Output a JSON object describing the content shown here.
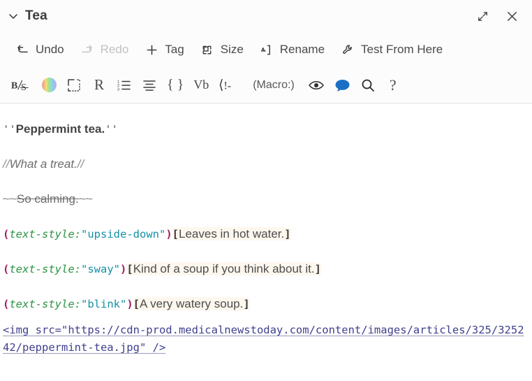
{
  "window": {
    "passage_title": "Tea",
    "collapse_icon": "chevron-down-icon",
    "maximize_label": "Expand",
    "close_label": "Close"
  },
  "menubar": {
    "items": [
      {
        "label": "Undo",
        "icon": "undo-arrow-icon",
        "disabled": false
      },
      {
        "label": "Redo",
        "icon": "redo-arrow-icon",
        "disabled": true
      },
      {
        "label": "Tag",
        "icon": "plus-icon",
        "disabled": false
      },
      {
        "label": "Size",
        "icon": "size-box-icon",
        "disabled": false
      },
      {
        "label": "Rename",
        "icon": "rename-icon",
        "disabled": false
      },
      {
        "label": "Test From Here",
        "icon": "wrench-icon",
        "disabled": false
      }
    ]
  },
  "toolbar": {
    "items": [
      {
        "name": "bold-strike-style-icon",
        "label": "B/S",
        "kind": "glyph-bs"
      },
      {
        "name": "text-color-icon",
        "label": "",
        "kind": "colorwheel"
      },
      {
        "name": "dashed-box-icon",
        "label": "",
        "kind": "dashed-box"
      },
      {
        "name": "rotated-r-icon",
        "label": "R",
        "kind": "glyph-serif"
      },
      {
        "name": "numbered-list-icon",
        "label": "",
        "kind": "numlist"
      },
      {
        "name": "align-center-icon",
        "label": "",
        "kind": "aligncenter"
      },
      {
        "name": "curly-braces-icon",
        "label": "{ }",
        "kind": "glyph-serif"
      },
      {
        "name": "verbatim-icon",
        "label": "Vb",
        "kind": "glyph-serif"
      },
      {
        "name": "comment-tag-icon",
        "label": "",
        "kind": "comment-tag"
      },
      {
        "name": "macro-icon",
        "label": "(Macro:)",
        "kind": "macro-text"
      },
      {
        "name": "eye-preview-icon",
        "label": "",
        "kind": "eye"
      },
      {
        "name": "speech-bubble-icon",
        "label": "",
        "kind": "bubble"
      },
      {
        "name": "search-icon",
        "label": "",
        "kind": "search"
      },
      {
        "name": "help-icon",
        "label": "?",
        "kind": "glyph-serif"
      }
    ]
  },
  "code": {
    "lines": [
      {
        "id": "line-bold-title",
        "segments": [
          {
            "cls": "tk-quotemark",
            "text": "''"
          },
          {
            "cls": "tk-bold",
            "text": "Peppermint tea."
          },
          {
            "cls": "tk-quotemark",
            "text": "''"
          }
        ]
      },
      {
        "id": "line-italic",
        "segments": [
          {
            "cls": "tk-em-marker",
            "text": "//"
          },
          {
            "cls": "tk-em",
            "text": "What a treat."
          },
          {
            "cls": "tk-em-marker",
            "text": "//"
          }
        ]
      },
      {
        "id": "line-strike",
        "segments": [
          {
            "cls": "tk-strike-mk",
            "text": "~~"
          },
          {
            "cls": "tk-strike",
            "text": "So calming."
          },
          {
            "cls": "tk-strike-mk",
            "text": "~~"
          }
        ]
      },
      {
        "id": "line-macro-upside-down",
        "segments": [
          {
            "cls": "tk-paren",
            "text": "("
          },
          {
            "cls": "tk-macro",
            "text": "text-style:"
          },
          {
            "cls": "tk-string",
            "text": "\"upside-down\""
          },
          {
            "cls": "tk-paren",
            "text": ")"
          },
          {
            "cls": "tk-bracket",
            "text": "["
          },
          {
            "cls": "tk-hooktext",
            "text": "Leaves in hot water."
          },
          {
            "cls": "tk-bracket",
            "text": "]"
          }
        ]
      },
      {
        "id": "line-macro-sway",
        "segments": [
          {
            "cls": "tk-paren",
            "text": "("
          },
          {
            "cls": "tk-macro",
            "text": "text-style:"
          },
          {
            "cls": "tk-string",
            "text": "\"sway\""
          },
          {
            "cls": "tk-paren",
            "text": ")"
          },
          {
            "cls": "tk-bracket",
            "text": "["
          },
          {
            "cls": "tk-hooktext",
            "text": "Kind of a soup if you think about it."
          },
          {
            "cls": "tk-bracket",
            "text": "]"
          }
        ]
      },
      {
        "id": "line-macro-blink",
        "segments": [
          {
            "cls": "tk-paren",
            "text": "("
          },
          {
            "cls": "tk-macro",
            "text": "text-style:"
          },
          {
            "cls": "tk-string",
            "text": "\"blink\""
          },
          {
            "cls": "tk-paren",
            "text": ")"
          },
          {
            "cls": "tk-bracket",
            "text": "["
          },
          {
            "cls": "tk-hooktext",
            "text": "A very watery soup."
          },
          {
            "cls": "tk-bracket",
            "text": "]"
          }
        ]
      },
      {
        "id": "line-img-tag",
        "wrap": true,
        "segments": [
          {
            "cls": "tk-img",
            "text": "<img src=\"https://cdn-prod.medicalnewstoday.com/content/images/articles/325/325242/peppermint-tea.jpg\" />"
          }
        ]
      }
    ]
  },
  "colors": {
    "accent_blue": "#1a6fc4",
    "macro_green": "#2e9444",
    "string_teal": "#1591a6",
    "paren_magenta": "#a01b60",
    "hook_highlight": "#fdf7ee",
    "link_purple": "#3f3f8f"
  }
}
